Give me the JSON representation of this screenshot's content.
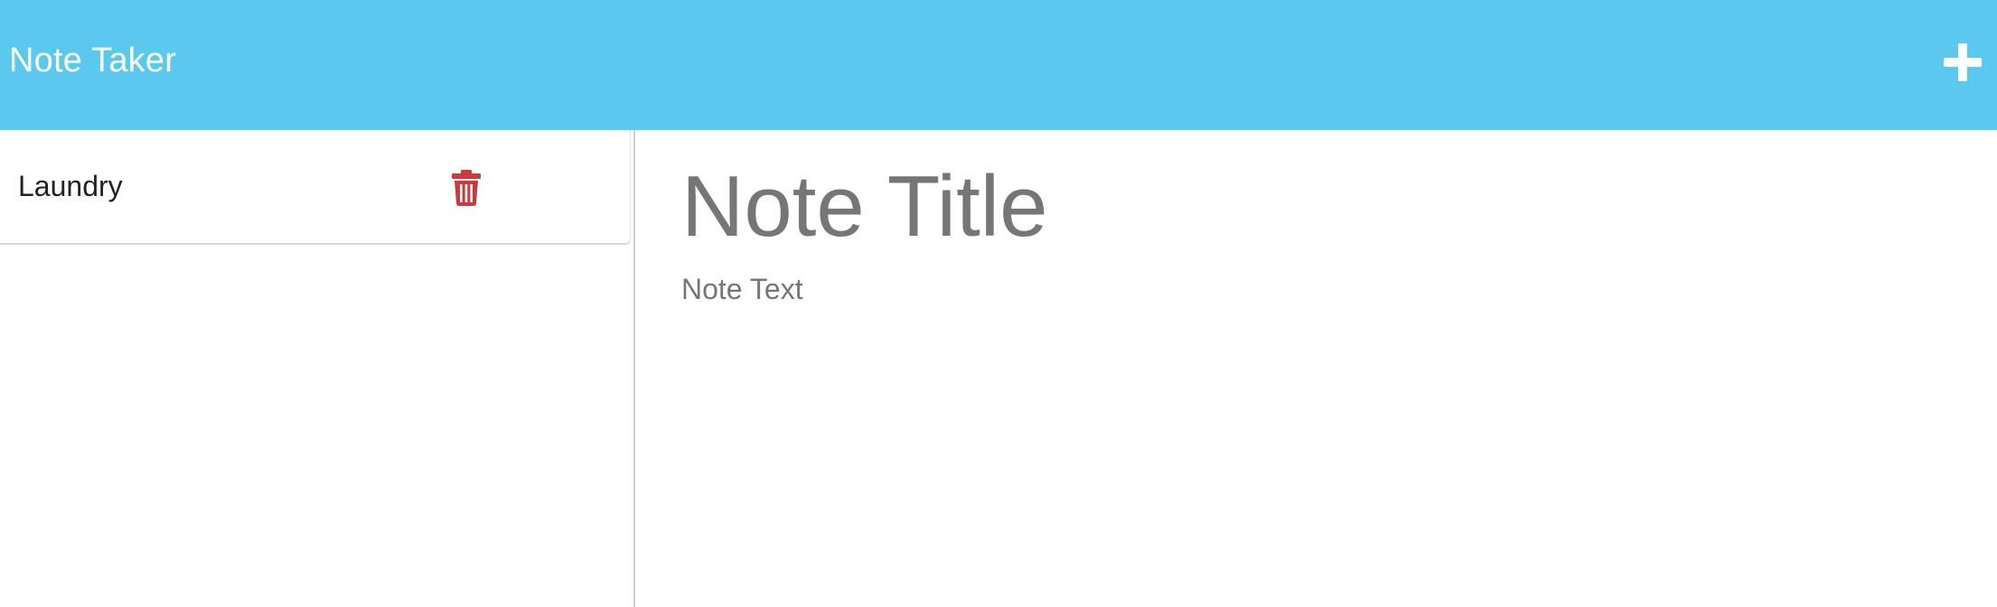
{
  "navbar": {
    "brand": "Note Taker",
    "new_note_icon": "plus-icon"
  },
  "notes": [
    {
      "title": "Laundry",
      "delete_icon": "trash-icon"
    }
  ],
  "editor": {
    "title_placeholder": "Note Title",
    "text_placeholder": "Note Text"
  },
  "colors": {
    "navbar": "#5bc8ee",
    "delete": "#cc3a3d",
    "placeholder": "#767676"
  }
}
